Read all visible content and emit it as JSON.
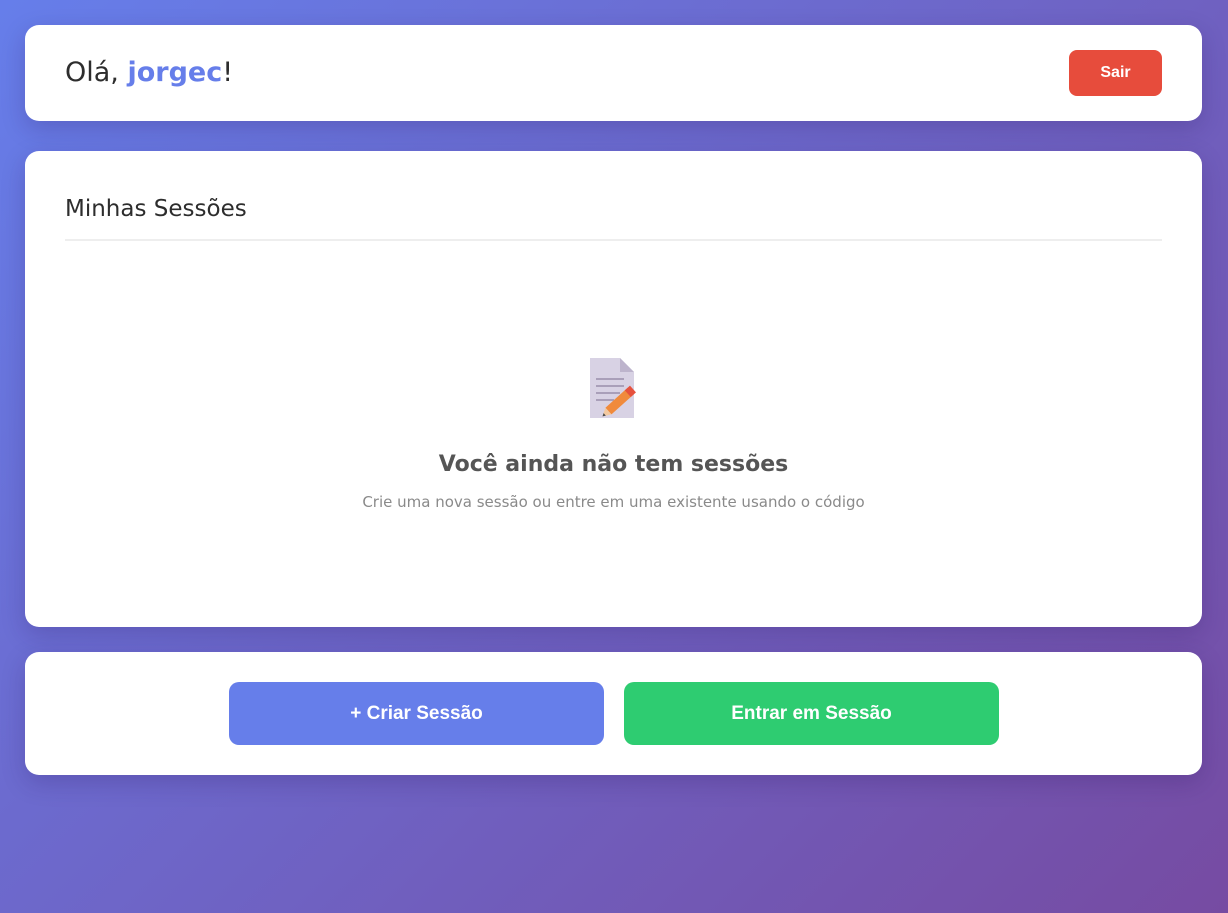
{
  "header": {
    "greeting_prefix": "Olá, ",
    "username": "jorgec",
    "greeting_suffix": "!",
    "logout_label": "Sair"
  },
  "sessions": {
    "title": "Minhas Sessões",
    "empty_state": {
      "icon": "memo-icon",
      "title": "Você ainda não tem sessões",
      "subtitle": "Crie uma nova sessão ou entre em uma existente usando o código"
    }
  },
  "actions": {
    "create_label": "+ Criar Sessão",
    "join_label": "Entrar em Sessão"
  },
  "colors": {
    "background_start": "#667eea",
    "background_end": "#764ba2",
    "accent": "#667eea",
    "logout": "#e74c3c",
    "join": "#2ecc71"
  }
}
